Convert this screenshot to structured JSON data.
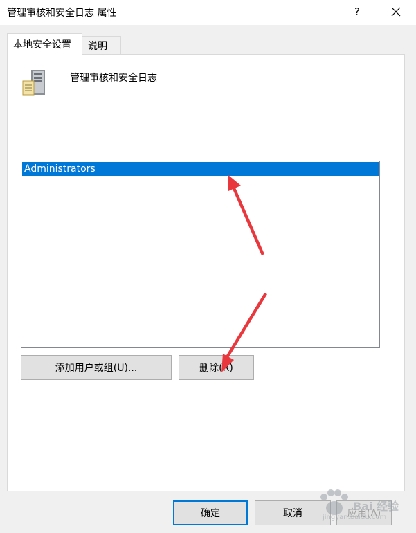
{
  "window": {
    "title": "管理审核和安全日志 属性",
    "help_label": "?"
  },
  "tabs": [
    {
      "label": "本地安全设置",
      "active": true
    },
    {
      "label": "说明",
      "active": false
    }
  ],
  "panel": {
    "policy_name": "管理审核和安全日志",
    "members": [
      {
        "label": "Administrators",
        "selected": true
      }
    ],
    "add_button_label": "添加用户或组(U)...",
    "remove_button_label": "删除(R)"
  },
  "footer": {
    "ok_label": "确定",
    "cancel_label": "取消",
    "apply_label": "应用(A)"
  },
  "watermark": {
    "brand": "Bai 经验",
    "url": "jingyan.baidu.com"
  },
  "colors": {
    "selection": "#0078d7",
    "annotation_arrow": "#e8383d"
  }
}
